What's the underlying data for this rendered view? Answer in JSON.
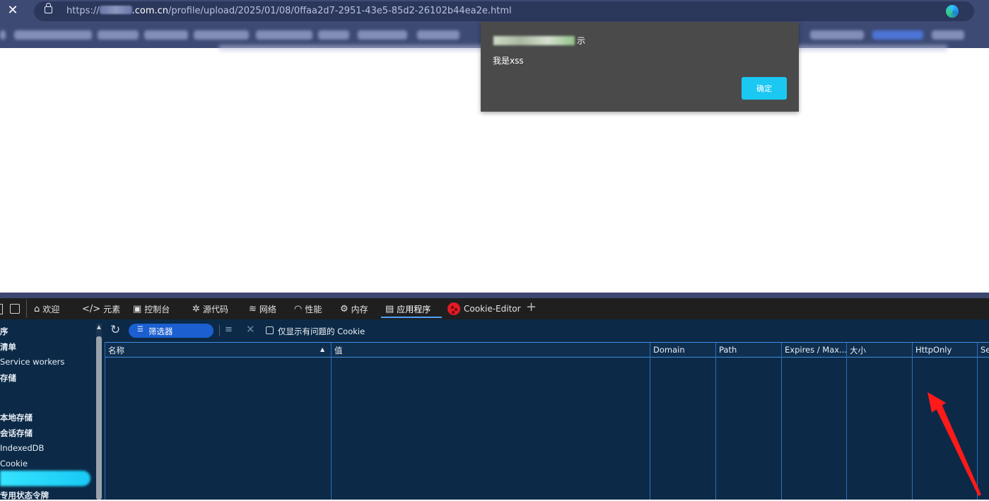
{
  "browser": {
    "url_prefix": "https://",
    "url_host": ".com.cn",
    "url_path": "/profile/upload/2025/01/08/0ffaa2d7-2951-43e5-85d2-26102b44ea2e.html",
    "close_glyph": "✕"
  },
  "dialog": {
    "origin_suffix": "示",
    "message": "我是xss",
    "ok_label": "确定"
  },
  "devtools": {
    "tabs": [
      {
        "icon": "⌂",
        "label": "欢迎"
      },
      {
        "icon": "</>",
        "label": "元素"
      },
      {
        "icon": "▣",
        "label": "控制台"
      },
      {
        "icon": "✲",
        "label": "源代码"
      },
      {
        "icon": "≋",
        "label": "网络"
      },
      {
        "icon": "◠",
        "label": "性能"
      },
      {
        "icon": "⚙",
        "label": "内存"
      },
      {
        "icon": "▤",
        "label": "应用程序"
      },
      {
        "icon": "",
        "label": "Cookie-Editor"
      }
    ],
    "add_tab_glyph": "+",
    "sidebar": [
      "序",
      "清单",
      "Service workers",
      "存储",
      "本地存储",
      "会话存储",
      "IndexedDB",
      "Cookie",
      "专用状态令牌"
    ],
    "filter": {
      "placeholder": "筛选器",
      "only_issues_label": "仅显示有问题的 Cookie"
    },
    "columns": [
      "名称",
      "值",
      "Domain",
      "Path",
      "Expires / Max...",
      "大小",
      "HttpOnly",
      "Se"
    ]
  },
  "annotation_color": "#ff1a1a"
}
